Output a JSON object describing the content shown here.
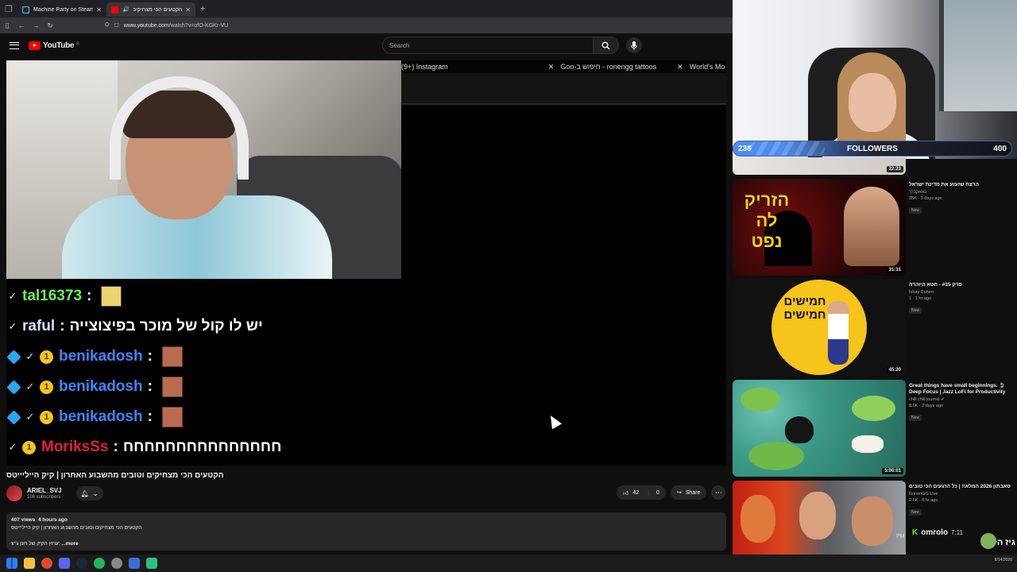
{
  "browser": {
    "tabs": [
      {
        "label": "Machine Party on Steam",
        "active": false,
        "favicon_color": "#1b2838"
      },
      {
        "label": "הקטעים הכי מצחיקים וטו",
        "active": true,
        "favicon_color": "#ff0000"
      }
    ],
    "url_host": "www.youtube.com",
    "url_path": "/watch?v=ofO-KGKr-VU"
  },
  "youtube": {
    "logo_text": "YouTube",
    "logo_country": "IL",
    "search_placeholder": "Search"
  },
  "player": {
    "overlay_tabs": [
      {
        "label": "(9+) Instagram"
      },
      {
        "label": "ronengg tattoos - חיפוש ב-Goo"
      },
      {
        "label": "World's Mo"
      }
    ],
    "chat": [
      {
        "user": "tal16373",
        "user_color": "#6ff05a",
        "message": "",
        "badges": [
          "check"
        ],
        "emote": "yellow"
      },
      {
        "user": "raful",
        "user_color": "#cfe3ff",
        "message": "יש לו קול של מוכר בפיצוצייה",
        "badges": [
          "check"
        ],
        "emote": ""
      },
      {
        "user": "benikadosh",
        "user_color": "#3f86f5",
        "message": "",
        "badges": [
          "cube",
          "check",
          "coin"
        ],
        "emote": "face"
      },
      {
        "user": "benikadosh",
        "user_color": "#3f86f5",
        "message": "",
        "badges": [
          "cube",
          "check",
          "coin"
        ],
        "emote": "face"
      },
      {
        "user": "benikadosh",
        "user_color": "#3f86f5",
        "message": "",
        "badges": [
          "cube",
          "check",
          "coin"
        ],
        "emote": "face"
      },
      {
        "user": "MoriksSs",
        "user_color": "#e02040",
        "message": "חחחחחחחחחחחחחחח",
        "badges": [
          "check",
          "coin"
        ],
        "emote": ""
      }
    ]
  },
  "video": {
    "title": "הקטעים הכי מצחיקים וטובים מהשבוע האחרון | קיק הייליייטס",
    "channel_name": "ARIEL_SVJ",
    "subscribers": "108 subscribers",
    "likes": "42",
    "dislikes": "0",
    "share_label": "Share",
    "views": "407 views",
    "age": "4 hours ago",
    "description_line1": "הקטעים הכי מצחיקים וטובים מהשבוע האחרון | קיק הייליייטס",
    "description_line2": "ערוץ הקיק של רונן ג'יצ:",
    "more_label": "...more"
  },
  "stream_overlay": {
    "followers_current": "238",
    "followers_label": "FOLLOWERS",
    "followers_goal": "400",
    "followers_progress": 0.595,
    "chat_user": "omrolo",
    "chat_time": "7:11",
    "chat_pm": "PM",
    "chat_message": "גיז הקרח"
  },
  "recommendations": [
    {
      "title": "",
      "channel": "",
      "stats": "",
      "duration": "22:23",
      "new": ""
    },
    {
      "title": "הרצח שזעזע את מדינת ישראל",
      "channel": "באאקברך",
      "stats": "35K · 3 days ago",
      "duration": "31:31",
      "new": "New",
      "thumb_text": "הזריק לה נפט"
    },
    {
      "title": "פרק #15 - חטא היוהרה",
      "channel": "Ishay Cohen",
      "stats": "1 · 1 hr ago",
      "duration": "45:20",
      "new": "New",
      "thumb_text": "חמישים חמישים"
    },
    {
      "title": "Great things have small beginnings. 🍃 Deep Focus | Jazz LoFi for Productivity",
      "channel": "chill chill journal",
      "stats": "8.6K · 2 days ago",
      "duration": "5:00:01",
      "new": "New"
    },
    {
      "title": "סאבתון 2026 המלא!! | כל הרגעים הכי טובים",
      "channel": "RonenGG Live",
      "stats": "2.6K · 6 hr ago",
      "duration": "",
      "new": "New"
    }
  ],
  "taskbar": {
    "date": "8/14/2026"
  }
}
